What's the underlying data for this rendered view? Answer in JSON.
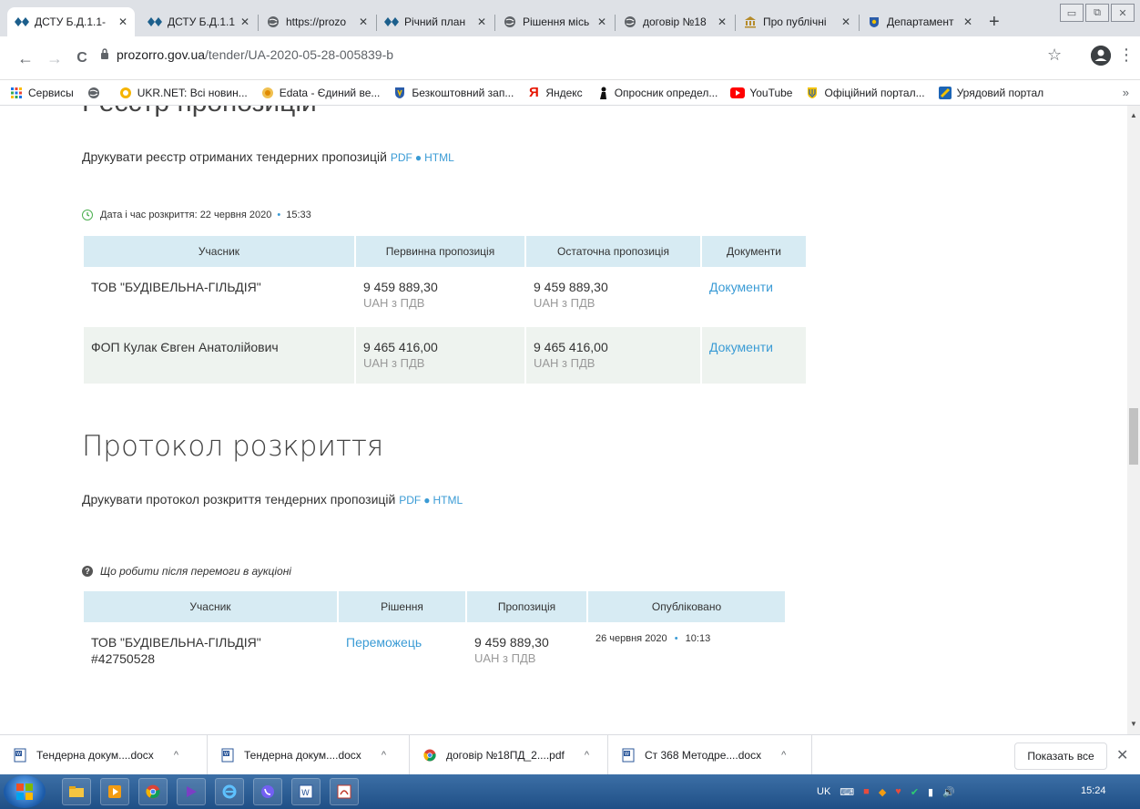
{
  "tabs": [
    {
      "title": "ДСТУ Б.Д.1.1-",
      "icon": "prozorro-icon",
      "active": true
    },
    {
      "title": "ДСТУ Б.Д.1.1-",
      "icon": "prozorro-icon",
      "active": false
    },
    {
      "title": "https://prozo",
      "icon": "globe-icon",
      "active": false
    },
    {
      "title": "Річний план",
      "icon": "prozorro-icon",
      "active": false
    },
    {
      "title": "Рішення місь",
      "icon": "globe-icon",
      "active": false
    },
    {
      "title": "договір №18",
      "icon": "globe-icon",
      "active": false
    },
    {
      "title": "Про публічні",
      "icon": "building-icon",
      "active": false
    },
    {
      "title": "Департамент",
      "icon": "emblem-icon",
      "active": false
    }
  ],
  "tab_close_glyph": "✕",
  "new_tab_glyph": "+",
  "window_controls": {
    "minimize": "▭",
    "restore": "⧉",
    "close": "✕"
  },
  "toolbar": {
    "back": "←",
    "forward": "→",
    "reload": "C",
    "lock": "🔒",
    "url_host": "prozorro.gov.ua",
    "url_path": "/tender/UA-2020-05-28-005839-b",
    "star": "☆",
    "profile": "●",
    "menu": "⋮"
  },
  "bookmarks": [
    {
      "label": "Сервисы",
      "icon": "apps-icon"
    },
    {
      "label": "",
      "icon": "globe-icon"
    },
    {
      "label": "UKR.NET: Всі новин...",
      "icon": "ukrnet-icon"
    },
    {
      "label": "Edata - Єдиний ве...",
      "icon": "edata-icon"
    },
    {
      "label": "Безкоштовний зап...",
      "icon": "shield-icon"
    },
    {
      "label": "Яндекс",
      "icon": "yandex-icon"
    },
    {
      "label": "Опросник определ...",
      "icon": "silhouette-icon"
    },
    {
      "label": "YouTube",
      "icon": "youtube-icon"
    },
    {
      "label": "Офіційний портал...",
      "icon": "trident-icon"
    },
    {
      "label": "Урядовий портал",
      "icon": "gov-portal-icon"
    }
  ],
  "bookmarks_more": "»",
  "content": {
    "cut_heading": "Реєстр пропозицій",
    "print_register": {
      "text": "Друкувати реєстр отриманих тендерних пропозицій",
      "pdf": "PDF",
      "dot": "●",
      "html": "HTML"
    },
    "open_date": {
      "label": "Дата і час розкриття: 22 червня 2020",
      "bullet": "•",
      "time": "15:33"
    },
    "bids_table": {
      "headers": [
        "Учасник",
        "Первинна пропозиція",
        "Остаточна пропозиція",
        "Документи"
      ],
      "rows": [
        {
          "participant": "ТОВ \"БУДІВЕЛЬНА-ГІЛЬДІЯ\"",
          "initial": "9 459 889,30",
          "initial_currency": "UAH з ПДВ",
          "final": "9 459 889,30",
          "final_currency": "UAH з ПДВ",
          "docs": "Документи"
        },
        {
          "participant": "ФОП Кулак Євген Анатолійович",
          "initial": "9 465 416,00",
          "initial_currency": "UAH з ПДВ",
          "final": "9 465 416,00",
          "final_currency": "UAH з ПДВ",
          "docs": "Документи"
        }
      ]
    },
    "protocol_heading": "Протокол розкриття",
    "print_protocol": {
      "text": "Друкувати протокол розкриття тендерних пропозицій",
      "pdf": "PDF",
      "dot": "●",
      "html": "HTML"
    },
    "question": {
      "icon": "?",
      "text": "Що робити після перемоги в аукціоні"
    },
    "result_table": {
      "headers": [
        "Учасник",
        "Рішення",
        "Пропозиція",
        "Опубліковано"
      ],
      "rows": [
        {
          "participant": "ТОВ \"БУДІВЕЛЬНА-ГІЛЬДІЯ\"",
          "edrpou": "#42750528",
          "decision": "Переможець",
          "amount": "9 459 889,30",
          "currency": "UAH з ПДВ",
          "published": "26 червня 2020",
          "bullet": "•",
          "time": "10:13"
        }
      ]
    }
  },
  "downloads": [
    {
      "name": "Тендерна докум....docx",
      "icon": "word-doc-icon"
    },
    {
      "name": "Тендерна докум....docx",
      "icon": "word-doc-icon"
    },
    {
      "name": "договір №18ПД_2....pdf",
      "icon": "chrome-pdf-icon"
    },
    {
      "name": "Ст 368 Методре....docx",
      "icon": "word-doc-icon"
    }
  ],
  "download_chevron": "^",
  "show_all": "Показать все",
  "shelf_close": "✕",
  "taskbar": {
    "lang": "UK",
    "clock": "15:24"
  },
  "colors": {
    "link": "#3a9bd5",
    "table_header": "#d7ebf3",
    "row_alt": "#eef3ef",
    "tabstrip": "#dee1e6"
  }
}
